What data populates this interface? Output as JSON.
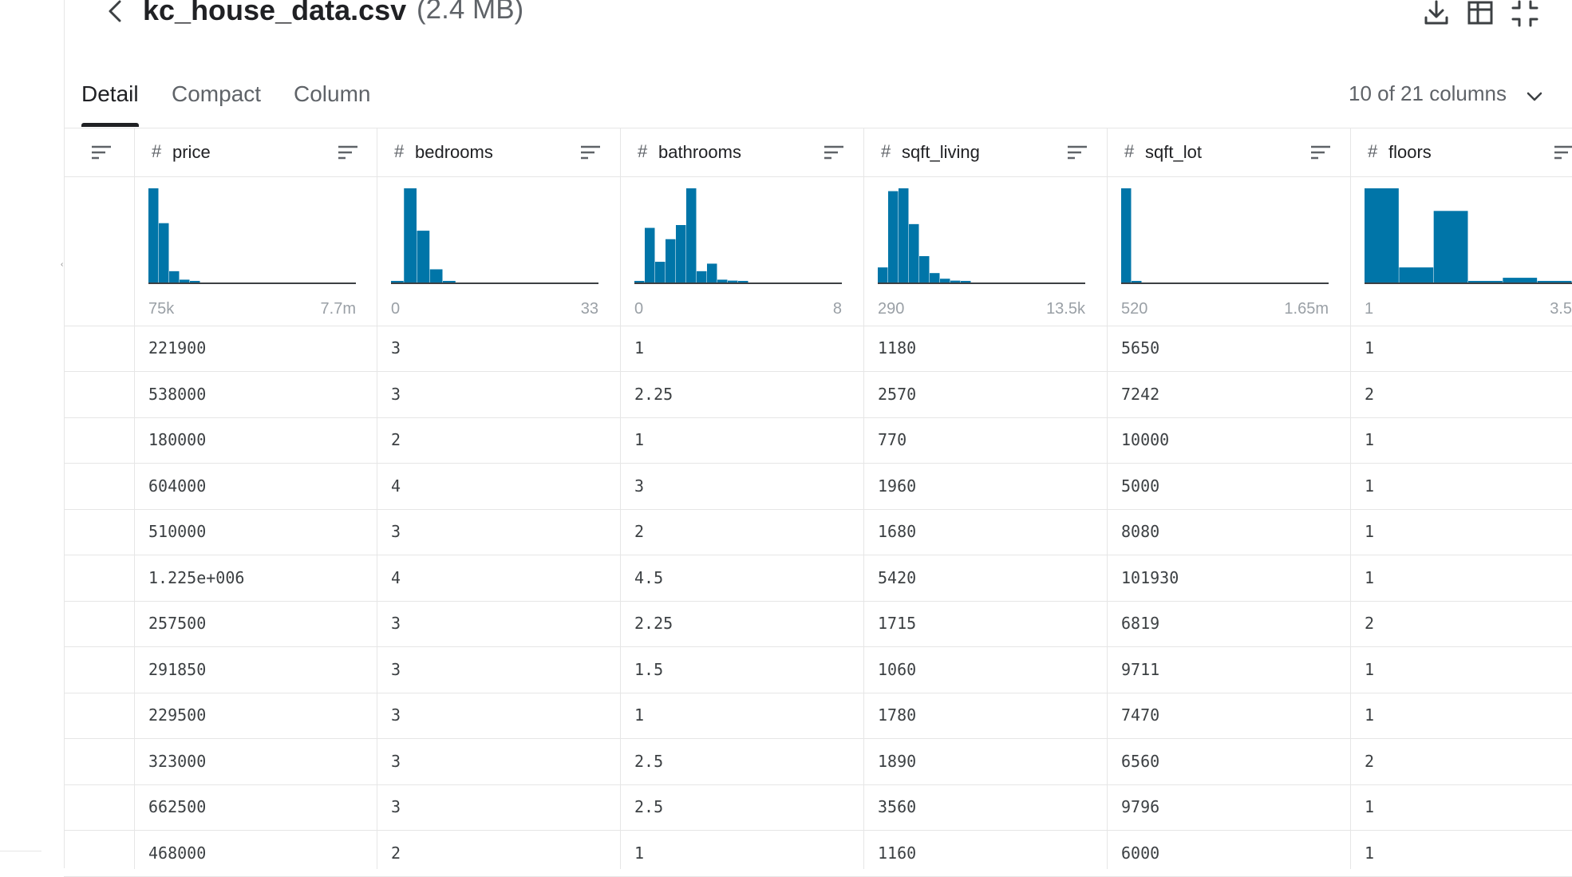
{
  "header": {
    "title": "kc_house_data.csv",
    "size": "(2.4 MB)"
  },
  "tabs": [
    {
      "label": "Detail"
    },
    {
      "label": "Compact"
    },
    {
      "label": "Column"
    }
  ],
  "columns_selector": "10 of 21 columns",
  "colors": {
    "bar": "#0075a8",
    "text": "#202124",
    "muted": "#5f6368",
    "grid": "#e6e6e6"
  },
  "columns": [
    {
      "name": "price",
      "min": "75k",
      "max": "7.7m",
      "histogram": [
        100,
        63,
        12,
        3,
        1,
        0,
        0,
        0,
        0,
        0,
        0,
        0,
        0,
        0,
        0,
        0,
        0,
        0,
        0,
        0
      ]
    },
    {
      "name": "bedrooms",
      "min": "0",
      "max": "33",
      "histogram": [
        1,
        100,
        55,
        14,
        1,
        0,
        0,
        0,
        0,
        0,
        0,
        0,
        0,
        0,
        0,
        0
      ]
    },
    {
      "name": "bathrooms",
      "min": "0",
      "max": "8",
      "histogram": [
        1,
        58,
        22,
        46,
        61,
        100,
        12,
        20,
        3,
        2,
        1,
        0,
        0,
        0,
        0,
        0,
        0,
        0,
        0,
        0
      ]
    },
    {
      "name": "sqft_living",
      "min": "290",
      "max": "13.5k",
      "histogram": [
        16,
        97,
        100,
        62,
        28,
        10,
        4,
        2,
        1,
        0,
        0,
        0,
        0,
        0,
        0,
        0,
        0,
        0,
        0,
        0
      ]
    },
    {
      "name": "sqft_lot",
      "min": "520",
      "max": "1.65m",
      "histogram": [
        100,
        1,
        0,
        0,
        0,
        0,
        0,
        0,
        0,
        0,
        0,
        0,
        0,
        0,
        0,
        0,
        0,
        0,
        0,
        0
      ]
    },
    {
      "name": "floors",
      "min": "1",
      "max": "3.5",
      "histogram": [
        100,
        16,
        76,
        1,
        5,
        1
      ]
    }
  ],
  "rows": [
    [
      "221900",
      "3",
      "1",
      "1180",
      "5650",
      "1"
    ],
    [
      "538000",
      "3",
      "2.25",
      "2570",
      "7242",
      "2"
    ],
    [
      "180000",
      "2",
      "1",
      "770",
      "10000",
      "1"
    ],
    [
      "604000",
      "4",
      "3",
      "1960",
      "5000",
      "1"
    ],
    [
      "510000",
      "3",
      "2",
      "1680",
      "8080",
      "1"
    ],
    [
      "1.225e+006",
      "4",
      "4.5",
      "5420",
      "101930",
      "1"
    ],
    [
      "257500",
      "3",
      "2.25",
      "1715",
      "6819",
      "2"
    ],
    [
      "291850",
      "3",
      "1.5",
      "1060",
      "9711",
      "1"
    ],
    [
      "229500",
      "3",
      "1",
      "1780",
      "7470",
      "1"
    ],
    [
      "323000",
      "3",
      "2.5",
      "1890",
      "6560",
      "2"
    ],
    [
      "662500",
      "3",
      "2.5",
      "3560",
      "9796",
      "1"
    ],
    [
      "468000",
      "2",
      "1",
      "1160",
      "6000",
      "1"
    ]
  ]
}
